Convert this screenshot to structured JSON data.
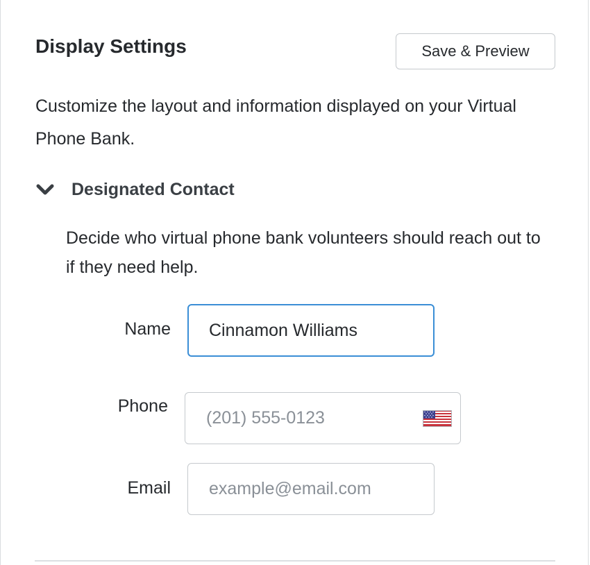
{
  "panel": {
    "title": "Display Settings",
    "save_button_label": "Save & Preview",
    "description": "Customize the layout and information displayed on your Virtual Phone Bank."
  },
  "section": {
    "expanded": true,
    "title": "Designated Contact",
    "description": "Decide who virtual phone bank volunteers should reach out to if they need help.",
    "chevron_icon": "chevron-down-icon"
  },
  "form": {
    "name": {
      "label": "Name",
      "value": "Cinnamon Williams",
      "focused": true
    },
    "phone": {
      "label": "Phone",
      "value": "",
      "placeholder": "(201) 555-0123",
      "country_icon": "us-flag-icon"
    },
    "email": {
      "label": "Email",
      "value": "",
      "placeholder": "example@email.com"
    }
  },
  "colors": {
    "focus_border": "#3a8ed6",
    "text": "#26292d",
    "placeholder": "#8a9097",
    "border": "#c5c9cd"
  }
}
